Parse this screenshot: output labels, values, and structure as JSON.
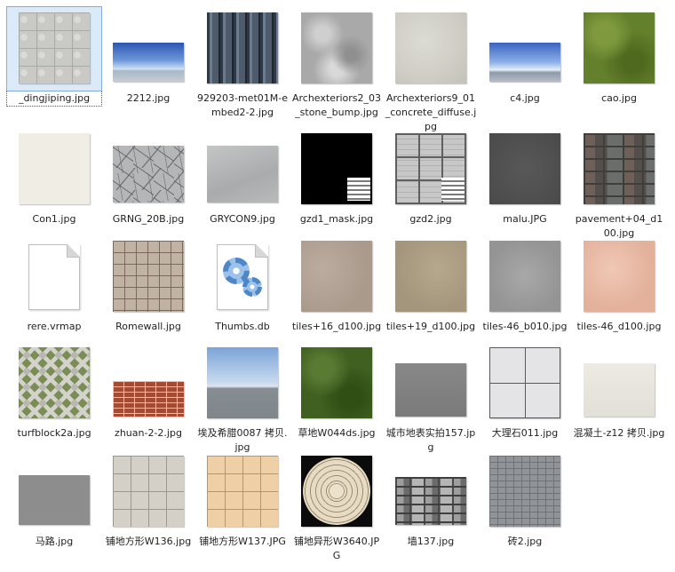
{
  "files": [
    {
      "label": "_dingjiping.jpg",
      "icon": "tiles-grey-thumbnail",
      "style": "t-tiles-grey",
      "selected": true
    },
    {
      "label": "2212.jpg",
      "icon": "sky-thumbnail",
      "style": "t-sky1"
    },
    {
      "label": "929203-met01M-embed2-2.jpg",
      "icon": "metal-grille-thumbnail",
      "style": "t-metal"
    },
    {
      "label": "Archexteriors2_03_stone_bump.jpg",
      "icon": "stone-bump-thumbnail",
      "style": "t-stone"
    },
    {
      "label": "Archexteriors9_01_concrete_diffuse.jpg",
      "icon": "concrete-thumbnail",
      "style": "t-concrete"
    },
    {
      "label": "c4.jpg",
      "icon": "sky-thumbnail",
      "style": "t-sky2"
    },
    {
      "label": "cao.jpg",
      "icon": "grass-thumbnail",
      "style": "t-grass"
    },
    {
      "label": "Con1.jpg",
      "icon": "light-concrete-thumbnail",
      "style": "t-con1"
    },
    {
      "label": "GRNG_20B.jpg",
      "icon": "cracked-ground-thumbnail",
      "style": "t-cracked"
    },
    {
      "label": "GRYCON9.jpg",
      "icon": "grey-concrete-thumbnail",
      "style": "t-grycon"
    },
    {
      "label": "gzd1_mask.jpg",
      "icon": "mask-thumbnail",
      "style": "t-mask"
    },
    {
      "label": "gzd2.jpg",
      "icon": "tile-grid-thumbnail",
      "style": "t-gzd2"
    },
    {
      "label": "malu.JPG",
      "icon": "asphalt-thumbnail",
      "style": "t-malu"
    },
    {
      "label": "pavement+04_d100.jpg",
      "icon": "pavement-thumbnail",
      "style": "t-pavement"
    },
    {
      "label": "rere.vrmap",
      "icon": "blank-file-icon",
      "style": "fileicon"
    },
    {
      "label": "Romewall.jpg",
      "icon": "wall-tiles-thumbnail",
      "style": "t-romewall"
    },
    {
      "label": "Thumbs.db",
      "icon": "system-file-gear-icon",
      "style": "fileicon-gear"
    },
    {
      "label": "tiles+16_d100.jpg",
      "icon": "tiles-thumbnail",
      "style": "t-tiles16"
    },
    {
      "label": "tiles+19_d100.jpg",
      "icon": "tiles-thumbnail",
      "style": "t-tiles19"
    },
    {
      "label": "tiles-46_b010.jpg",
      "icon": "tiles-thumbnail",
      "style": "t-tiles46b"
    },
    {
      "label": "tiles-46_d100.jpg",
      "icon": "tiles-thumbnail",
      "style": "t-tiles46d"
    },
    {
      "label": "turfblock2a.jpg",
      "icon": "turf-block-thumbnail",
      "style": "t-turf"
    },
    {
      "label": "zhuan-2-2.jpg",
      "icon": "brick-thumbnail",
      "style": "t-brick"
    },
    {
      "label": "埃及希腊0087 拷贝.jpg",
      "icon": "sky-horizon-thumbnail",
      "style": "t-sky3"
    },
    {
      "label": "草地W044ds.jpg",
      "icon": "grass-thumbnail",
      "style": "t-grass2"
    },
    {
      "label": "城市地表实拍157.jpg",
      "icon": "ground-thumbnail",
      "style": "t-ground"
    },
    {
      "label": "大理石011.jpg",
      "icon": "marble-thumbnail",
      "style": "t-marble"
    },
    {
      "label": "混凝土-z12 拷贝.jpg",
      "icon": "concrete-thumbnail",
      "style": "t-concrete2"
    },
    {
      "label": "马路.jpg",
      "icon": "road-thumbnail",
      "style": "t-road"
    },
    {
      "label": "铺地方形W136.jpg",
      "icon": "square-paving-thumbnail",
      "style": "t-w136"
    },
    {
      "label": "铺地方形W137.JPG",
      "icon": "square-paving-thumbnail",
      "style": "t-w137"
    },
    {
      "label": "铺地异形W3640.JPG",
      "icon": "circular-paving-thumbnail",
      "style": "t-circle"
    },
    {
      "label": "墙137.jpg",
      "icon": "stone-wall-thumbnail",
      "style": "t-wall137"
    },
    {
      "label": "砖2.jpg",
      "icon": "brick-thumbnail",
      "style": "t-bricks2"
    }
  ]
}
